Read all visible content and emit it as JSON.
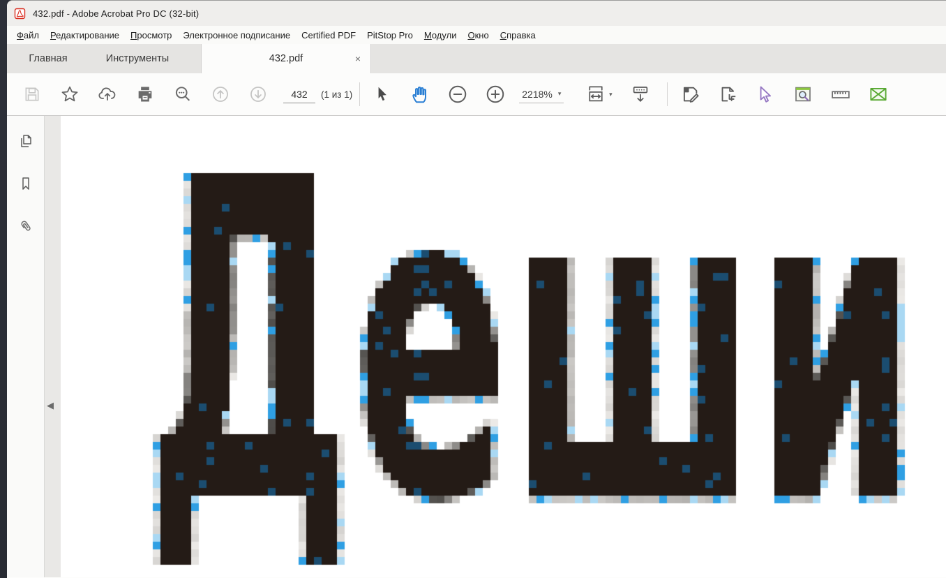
{
  "window": {
    "title": "432.pdf - Adobe Acrobat Pro DC (32-bit)"
  },
  "menu_bar": {
    "items": [
      {
        "label": "Файл",
        "underline_first": true
      },
      {
        "label": "Редактирование",
        "underline_first": true
      },
      {
        "label": "Просмотр",
        "underline_first": true
      },
      {
        "label": "Электронное подписание",
        "underline_first": false
      },
      {
        "label": "Certified PDF",
        "underline_first": false
      },
      {
        "label": "PitStop Pro",
        "underline_first": false
      },
      {
        "label": "Модули",
        "underline_first": true
      },
      {
        "label": "Окно",
        "underline_first": true
      },
      {
        "label": "Справка",
        "underline_first": true
      }
    ]
  },
  "tab_bar": {
    "tabs": [
      {
        "label": "Главная",
        "active": false
      },
      {
        "label": "Инструменты",
        "active": false
      },
      {
        "label": "432.pdf",
        "active": true,
        "close_glyph": "×"
      }
    ]
  },
  "toolbar": {
    "page_number_value": "432",
    "page_count_label": "(1 из 1)",
    "zoom_value": "2218%",
    "dropdown_caret_glyph": "▾",
    "icon_names": [
      "save-icon",
      "star-favorites-icon",
      "cloud-upload-icon",
      "print-icon",
      "search-icon",
      "page-up-icon",
      "page-down-icon",
      "select-tool-icon",
      "hand-tool-icon",
      "zoom-out-icon",
      "zoom-in-icon",
      "fit-width-icon",
      "scrolling-mode-icon",
      "edit-pdf-icon",
      "crop-pages-icon",
      "pitstop-select-icon",
      "pitstop-inspector-icon",
      "measure-icon",
      "certified-pdf-envelope-icon"
    ]
  },
  "sidebar": {
    "icon_names": [
      "page-thumbnails-icon",
      "bookmarks-icon",
      "attachments-icon"
    ],
    "collapse_glyph": "◀"
  },
  "document": {
    "visible_text": "Деши",
    "zoom_percent": 2218,
    "page_color": "#ffffff",
    "ink_color": "#241b16",
    "ink_blue_dark": "#1b4d70",
    "artifact_blue": "#2f9fe3",
    "artifact_blue_light": "#a9d8f3"
  },
  "colors": {
    "accent_blue": "#2a7fd4",
    "pitstop_purple": "#9576c2",
    "inspector_green": "#8cc63f",
    "envelope_green": "#58a832",
    "disabled_gray": "#c7c7c6",
    "icon_gray": "#636363"
  }
}
